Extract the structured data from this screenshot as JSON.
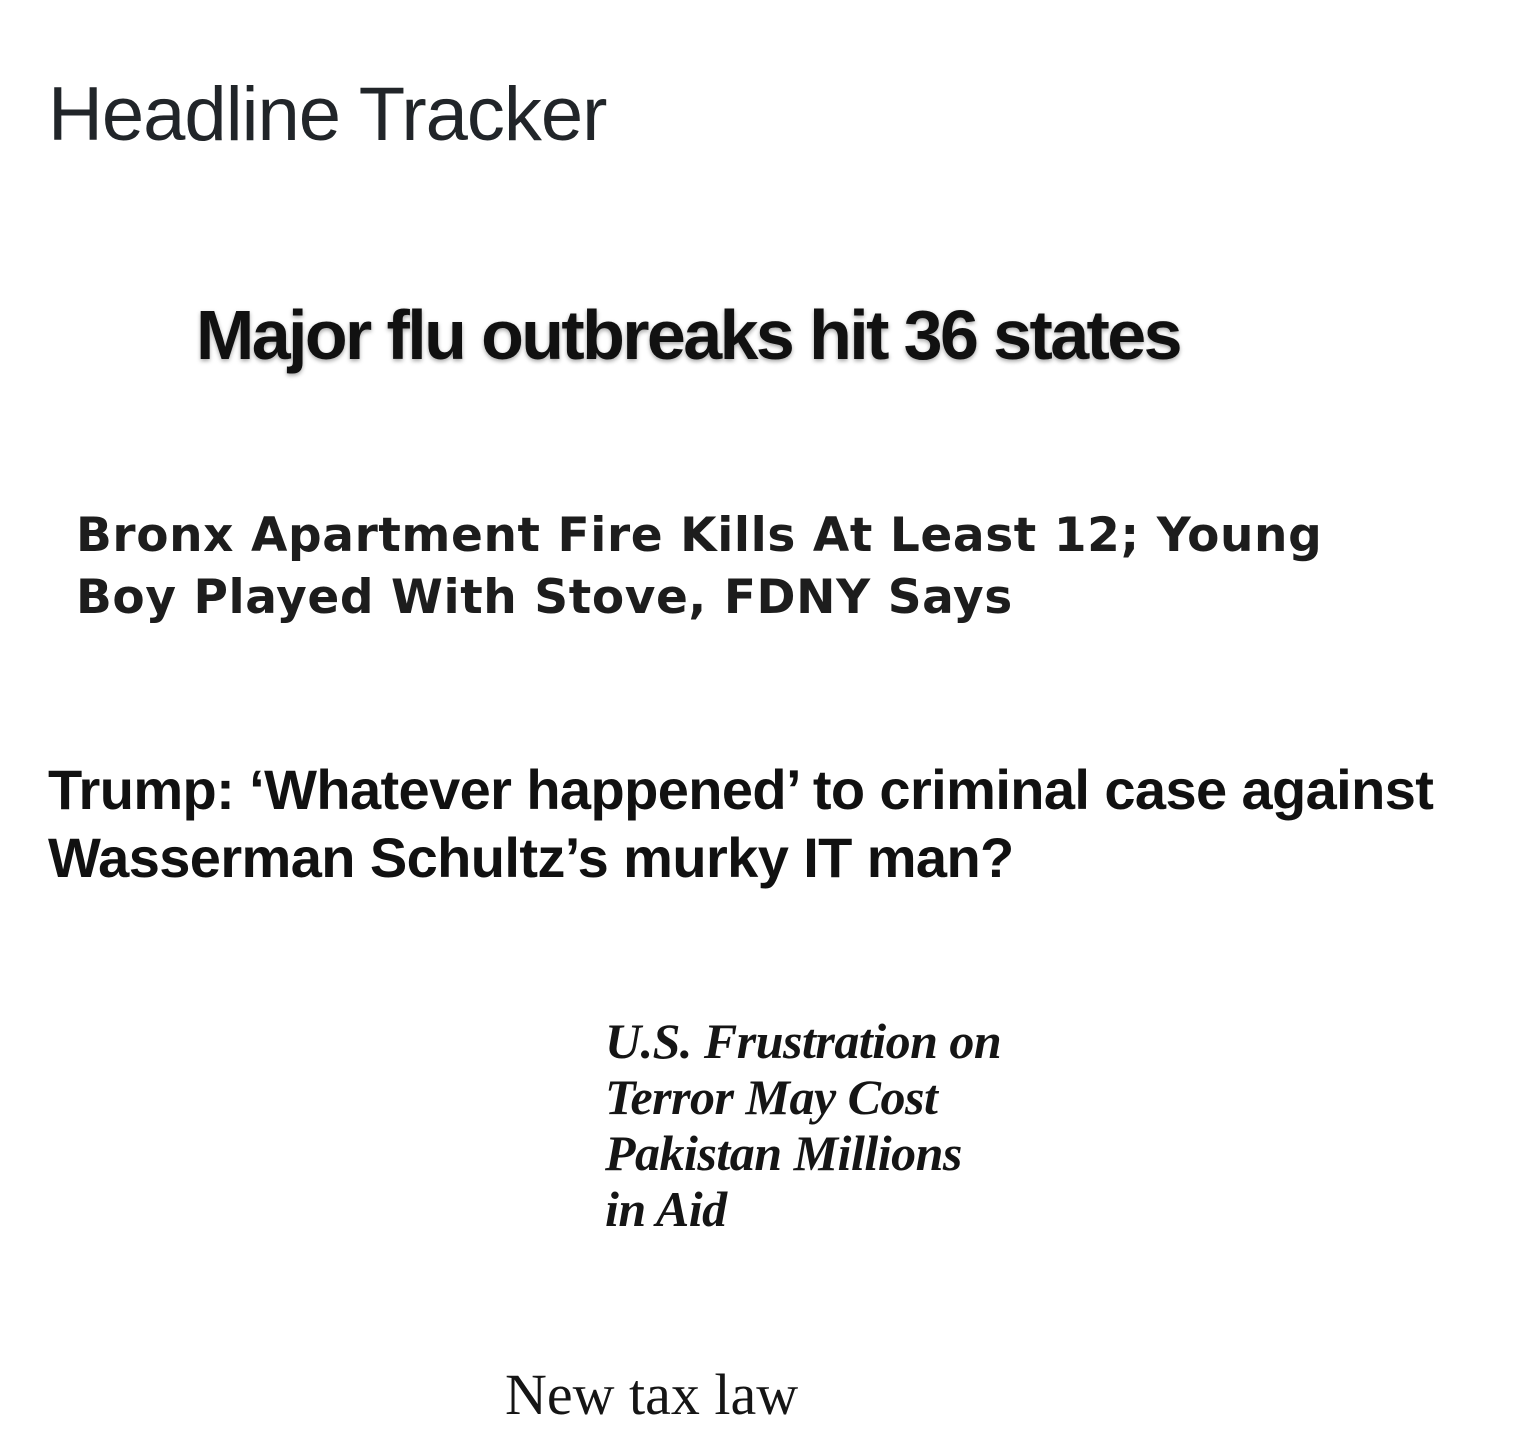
{
  "page": {
    "title": "Headline Tracker"
  },
  "headlines": [
    {
      "text": "Major flu outbreaks hit 36 states"
    },
    {
      "text": "Bronx Apartment Fire Kills At Least 12; Young Boy Played With Stove, FDNY Says"
    },
    {
      "text": "Trump: ‘Whatever happened’ to criminal case against Wasserman Schultz’s murky IT man?"
    },
    {
      "text": "U.S. Frustration on Terror May Cost Pakistan Millions in Aid"
    },
    {
      "text": "New tax law"
    }
  ],
  "colors": {
    "title_text": "#212529",
    "headline_text": "#111111",
    "background": "#ffffff"
  }
}
